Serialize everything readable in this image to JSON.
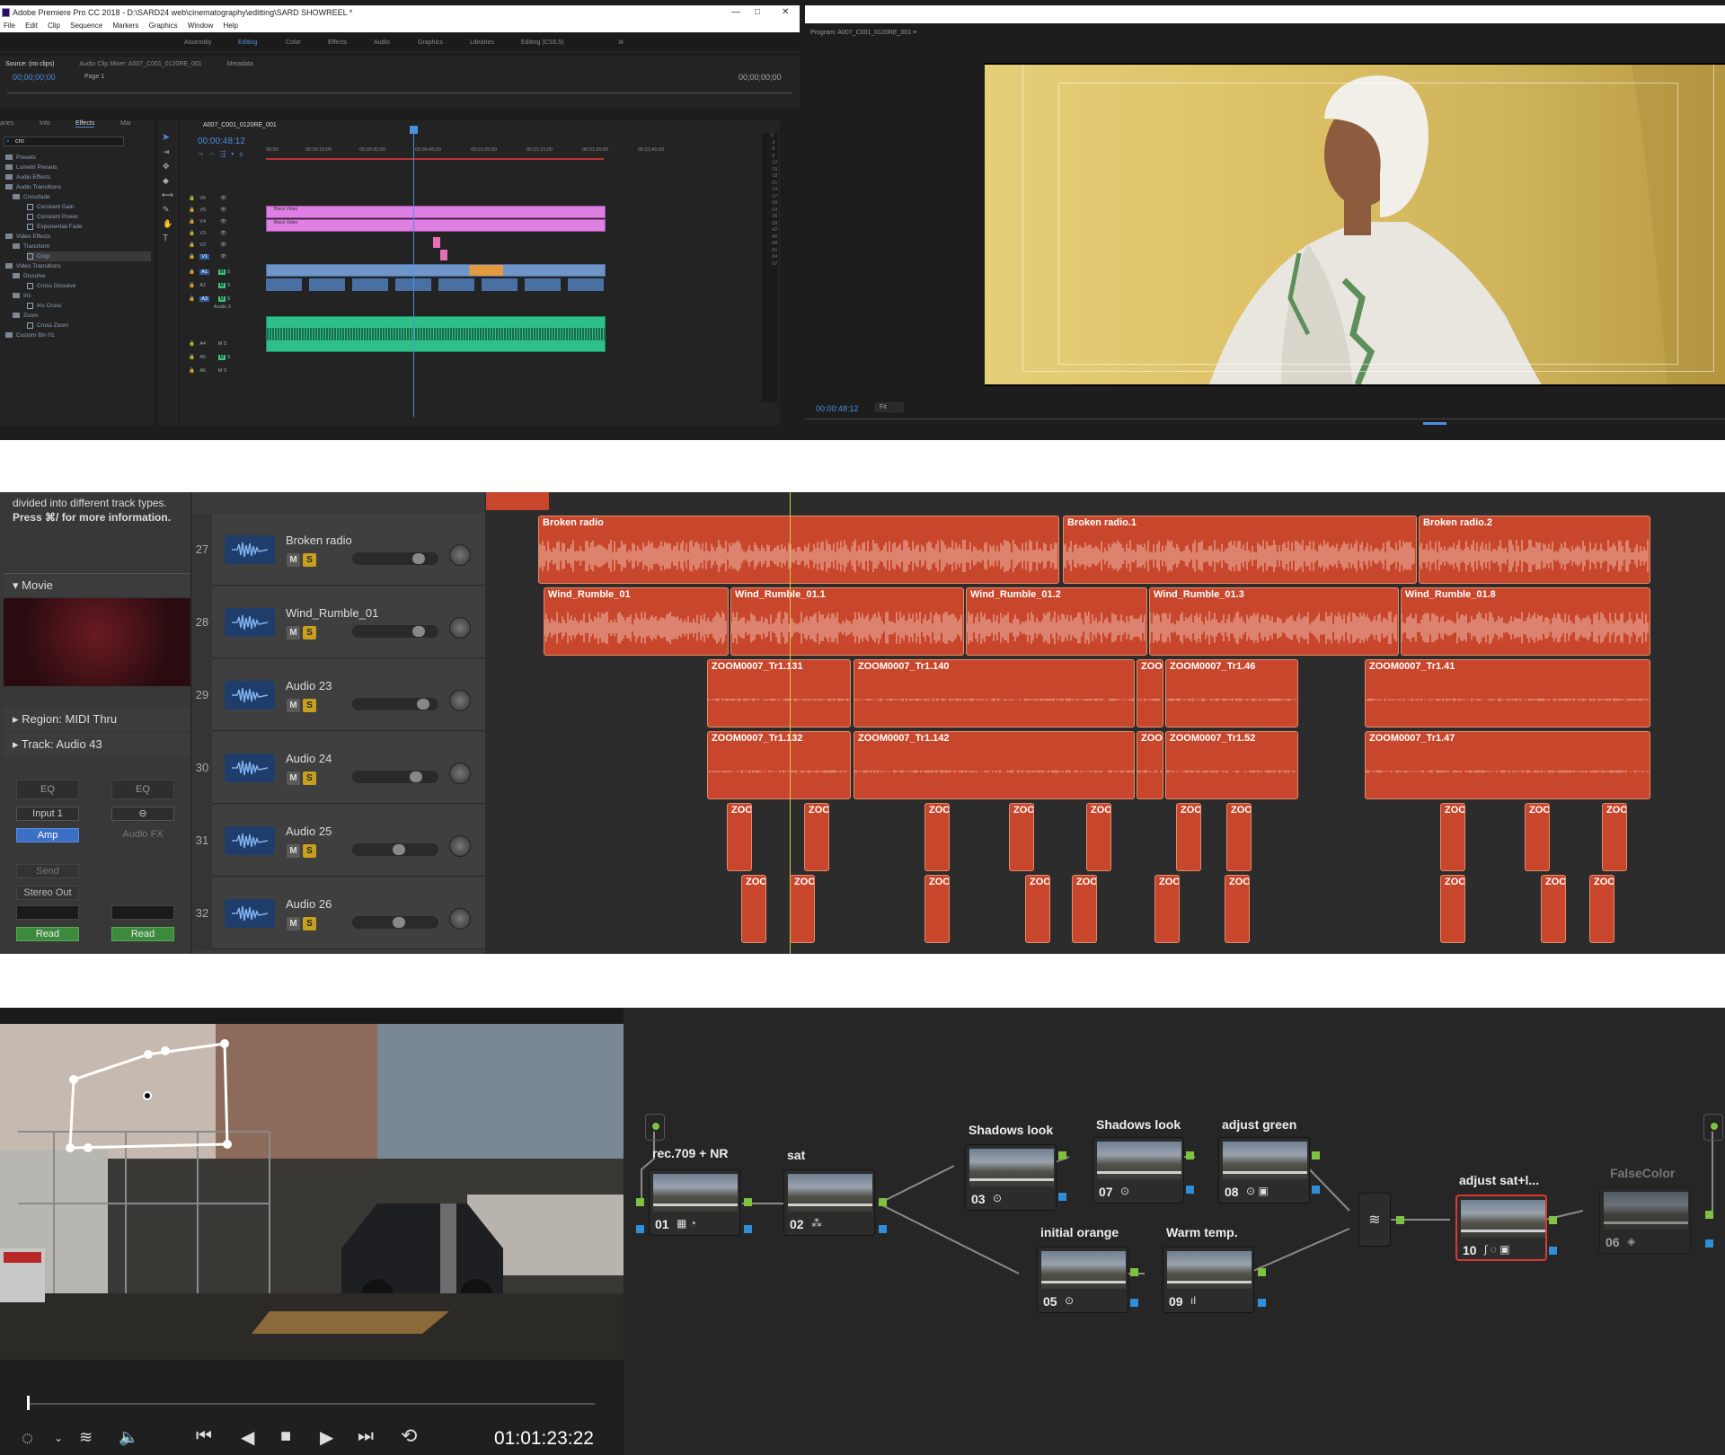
{
  "premiere": {
    "title": "Adobe Premiere Pro CC 2018 - D:\\SARD24 web\\cinematography\\editting\\SARD SHOWREEL *",
    "window_controls": [
      "—",
      "□",
      "✕"
    ],
    "menu": [
      "File",
      "Edit",
      "Clip",
      "Sequence",
      "Markers",
      "Graphics",
      "Window",
      "Help"
    ],
    "workspaces": [
      "Assembly",
      "Editing",
      "Color",
      "Effects",
      "Audio",
      "Graphics",
      "Libraries",
      "Editing (CS5.5)"
    ],
    "workspace_more": "»",
    "source_tabs": [
      "Source: (no clips)",
      "Audio Clip Mixer: A007_C001_0120RE_001",
      "Metadata"
    ],
    "source_tc_left": "00;00;00;00",
    "source_page": "Page 1",
    "source_tc_right": "00;00;00;00",
    "panel_tabs": [
      "aries",
      "Info",
      "Effects",
      "Mar"
    ],
    "search_value": "cro",
    "effects_tree": [
      "Presets",
      "Lumetri Presets",
      "Audio Effects",
      "Audio Transitions",
      "Crossfade",
      "Constant Gain",
      "Constant Power",
      "Exponential Fade",
      "Video Effects",
      "Transform",
      "Crop",
      "Video Transitions",
      "Dissolve",
      "Cross Dissolve",
      "Iris",
      "Iris Cross",
      "Zoom",
      "Cross Zoom",
      "Custom Bin 01"
    ],
    "sequence_tab": "A007_C001_0120RE_001",
    "sequence_tc": "00:00:48:12",
    "ruler": [
      "00:00",
      "00:00:15:00",
      "00:00:30:00",
      "00:00:45:00",
      "00:01:00:00",
      "00:01:15:00",
      "00:01:30:00",
      "00:01:45:00"
    ],
    "video_tracks": [
      "V6",
      "V5",
      "V4",
      "V3",
      "V2",
      "V1"
    ],
    "audio_tracks": [
      "A1",
      "A2",
      "A3",
      "A4",
      "A5",
      "A6"
    ],
    "clip_black_video": "Black Video",
    "audio3_label": "Audio 3",
    "track_m": "M",
    "track_s": "S",
    "meter_scale": [
      "0",
      "-3",
      "-6",
      "-9",
      "-12",
      "-15",
      "-18",
      "-21",
      "-24",
      "-27",
      "-30",
      "-33",
      "-36",
      "-39",
      "-42",
      "-45",
      "-48",
      "-51",
      "-54",
      "-57"
    ],
    "program_tab": "Program: A007_C001_0120RE_001",
    "program_tc": "00:00:48:12",
    "program_fit": "Fit"
  },
  "logic": {
    "help_text_1": "divided into different track types.",
    "help_text_2": "Press ⌘/ for more information.",
    "movie_label": "Movie",
    "region_label": "Region: MIDI Thru",
    "track_label": "Track: Audio 43",
    "strip1": {
      "eq": "EQ",
      "input": "Input 1",
      "amp": "Amp",
      "send": "Send",
      "out": "Stereo Out",
      "read": "Read"
    },
    "strip2": {
      "eq": "EQ",
      "fx": "Audio FX",
      "read": "Read"
    },
    "tracks": [
      {
        "num": "27",
        "name": "Broken radio",
        "fader": 0.82
      },
      {
        "num": "28",
        "name": "Wind_Rumble_01",
        "fader": 0.82
      },
      {
        "num": "29",
        "name": "Audio 23",
        "fader": 0.88
      },
      {
        "num": "30",
        "name": "Audio 24",
        "fader": 0.78
      },
      {
        "num": "31",
        "name": "Audio 25",
        "fader": 0.55
      },
      {
        "num": "32",
        "name": "Audio 26",
        "fader": 0.55
      }
    ],
    "mute": "M",
    "solo": "S",
    "regions": {
      "broken": [
        "Broken radio",
        "Broken radio.1",
        "Broken radio.2"
      ],
      "wind": [
        "Wind_Rumble_01",
        "Wind_Rumble_01.1",
        "Wind_Rumble_01.2",
        "Wind_Rumble_01.3",
        "Wind_Rumble_01.8"
      ],
      "row29": [
        "ZOOM0007_Tr1.131",
        "ZOOM0007_Tr1.140",
        "ZOO",
        "ZOOM0007_Tr1.46",
        "ZOOM0007_Tr1.41"
      ],
      "row30": [
        "ZOOM0007_Tr1.132",
        "ZOOM0007_Tr1.142",
        "ZOO",
        "ZOOM0007_Tr1.52",
        "ZOOM0007_Tr1.47"
      ],
      "short": "ZOO"
    }
  },
  "resolve": {
    "timecode": "01:01:23:22",
    "nodes": [
      {
        "num": "01",
        "label": "rec.709 + NR",
        "icons": "▦ ◔"
      },
      {
        "num": "02",
        "label": "sat",
        "icons": "⁂"
      },
      {
        "num": "03",
        "label": "Shadows look",
        "icons": "⊙"
      },
      {
        "num": "07",
        "label": "Shadows look",
        "icons": "⊙"
      },
      {
        "num": "08",
        "label": "adjust green",
        "icons": "⊙ ▣"
      },
      {
        "num": "05",
        "label": "initial orange",
        "icons": "⊙"
      },
      {
        "num": "09",
        "label": "Warm temp.",
        "icons": "ıl"
      },
      {
        "num": "10",
        "label": "adjust sat+l...",
        "icons": "∫ ◌ ▣"
      },
      {
        "num": "06",
        "label": "FalseColor",
        "icons": "◈"
      }
    ],
    "colors": {
      "green": "#7fc241",
      "blue": "#2e8fd8",
      "selected": "#d63a32"
    }
  }
}
